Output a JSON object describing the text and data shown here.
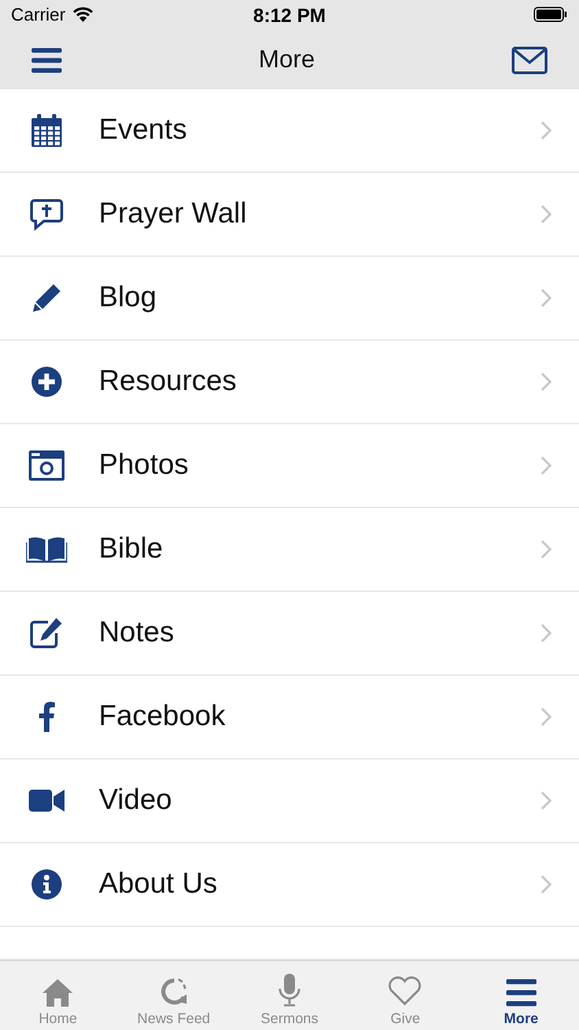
{
  "status_bar": {
    "carrier": "Carrier",
    "time": "8:12 PM"
  },
  "nav_bar": {
    "title": "More"
  },
  "items": [
    {
      "kind": "calendar",
      "label": "Events"
    },
    {
      "kind": "prayer",
      "label": "Prayer Wall"
    },
    {
      "kind": "pencil",
      "label": "Blog"
    },
    {
      "kind": "plus",
      "label": "Resources"
    },
    {
      "kind": "camera",
      "label": "Photos"
    },
    {
      "kind": "book",
      "label": "Bible"
    },
    {
      "kind": "notes",
      "label": "Notes"
    },
    {
      "kind": "facebook",
      "label": "Facebook"
    },
    {
      "kind": "video",
      "label": "Video"
    },
    {
      "kind": "info",
      "label": "About Us"
    }
  ],
  "tab_bar": [
    {
      "kind": "home",
      "label": "Home",
      "selected": false
    },
    {
      "kind": "feed",
      "label": "News Feed",
      "selected": false
    },
    {
      "kind": "mic",
      "label": "Sermons",
      "selected": false
    },
    {
      "kind": "heart",
      "label": "Give",
      "selected": false
    },
    {
      "kind": "menu",
      "label": "More",
      "selected": true
    }
  ]
}
